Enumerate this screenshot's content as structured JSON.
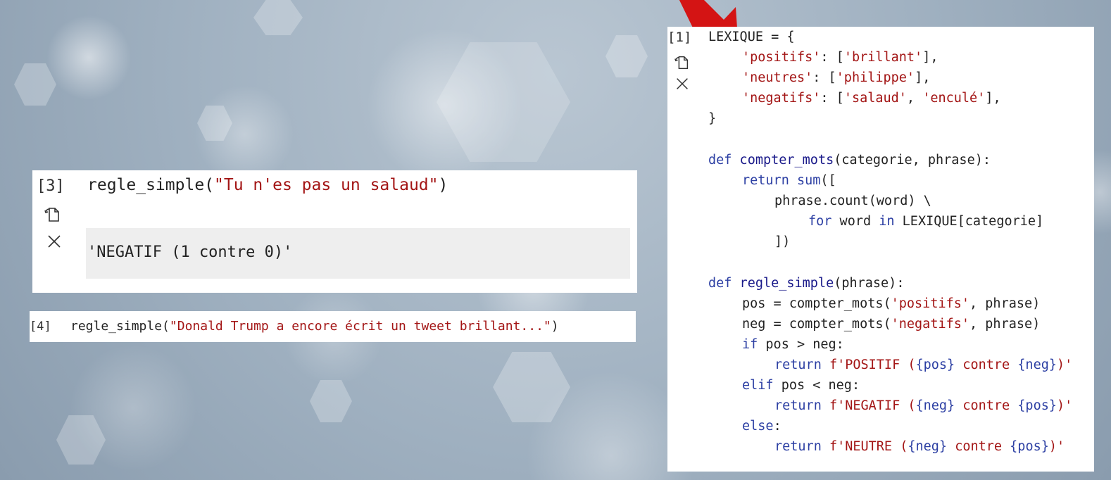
{
  "cells": {
    "cell3": {
      "prompt": "[3]",
      "code": {
        "fn": "regle_simple(",
        "arg": "\"Tu n'es pas un salaud\"",
        "close": ")"
      },
      "output": "'NEGATIF (1 contre 0)'"
    },
    "cell4": {
      "prompt": "[4]",
      "code": {
        "fn": "regle_simple(",
        "arg": "\"Donald Trump a encore écrit un tweet brillant...\"",
        "close": ")"
      }
    },
    "cell1": {
      "prompt": "[1]",
      "lines": {
        "l1": "LEXIQUE = {",
        "l2_key": "'positifs'",
        "l2_rest": ": [",
        "l2_val": "'brillant'",
        "l2_end": "],",
        "l3_key": "'neutres'",
        "l3_rest": ": [",
        "l3_val": "'philippe'",
        "l3_end": "],",
        "l4_key": "'negatifs'",
        "l4_rest": ": [",
        "l4_val1": "'salaud'",
        "l4_sep": ", ",
        "l4_val2": "'enculé'",
        "l4_end": "],",
        "l5": "}",
        "l7_def": "def",
        "l7_name": " compter_mots",
        "l7_args": "(categorie, phrase):",
        "l8_ret": "return",
        "l8_sum": " sum",
        "l8_rest": "([",
        "l9": "phrase.count(word) \\",
        "l10_for": "for",
        "l10_mid": " word ",
        "l10_in": "in",
        "l10_rest": " LEXIQUE[categorie]",
        "l11": "])",
        "l13_def": "def",
        "l13_name": " regle_simple",
        "l13_args": "(phrase):",
        "l14_a": "pos = compter_mots(",
        "l14_s": "'positifs'",
        "l14_b": ", phrase)",
        "l15_a": "neg = compter_mots(",
        "l15_s": "'negatifs'",
        "l15_b": ", phrase)",
        "l16_if": "if",
        "l16_rest": " pos > neg:",
        "l17_ret": "return",
        "l17_f": " f'POSITIF (",
        "l17_v1": "{pos}",
        "l17_m": " contre ",
        "l17_v2": "{neg}",
        "l17_e": ")'",
        "l18_elif": "elif",
        "l18_rest": " pos < neg:",
        "l19_ret": "return",
        "l19_f": " f'NEGATIF (",
        "l19_v1": "{neg}",
        "l19_m": " contre ",
        "l19_v2": "{pos}",
        "l19_e": ")'",
        "l20_else": "else",
        "l20_rest": ":",
        "l21_ret": "return",
        "l21_f": " f'NEUTRE (",
        "l21_v1": "{neg}",
        "l21_m": " contre ",
        "l21_v2": "{pos}",
        "l21_e": ")'"
      }
    }
  },
  "icons": {
    "copy": "copy-icon",
    "close": "close-icon",
    "arrow": "red-arrow"
  },
  "colors": {
    "string": "#a31515",
    "keyword": "#2c3fa3",
    "arrow": "#d41414"
  }
}
